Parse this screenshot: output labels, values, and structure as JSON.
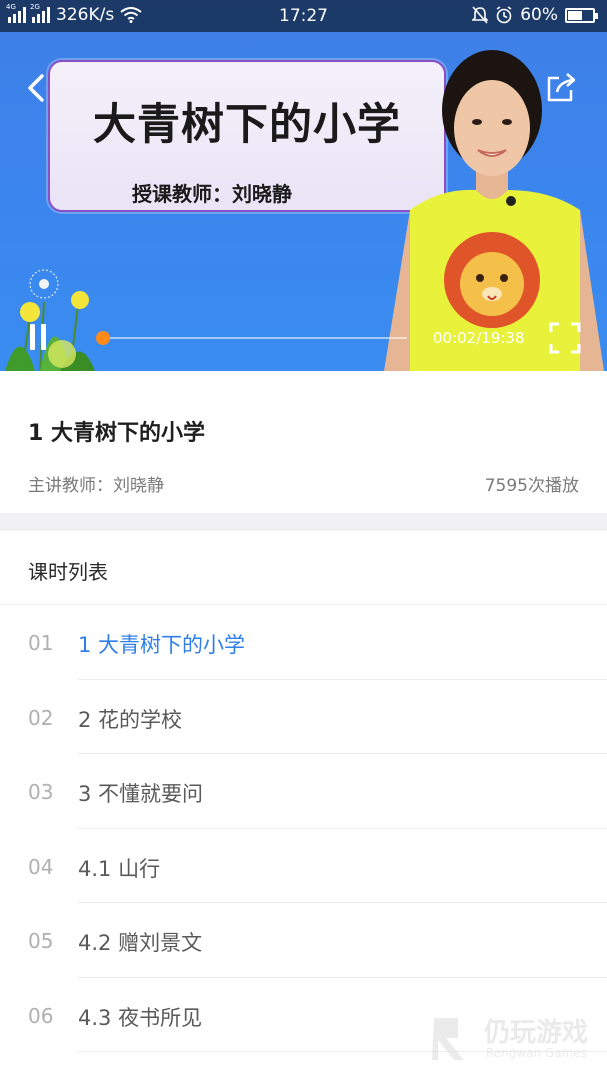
{
  "status_bar": {
    "signal_1_tag": "4G",
    "signal_2_tag": "2G",
    "network_speed": "326K/s",
    "time": "17:27",
    "battery_percent": "60%",
    "battery_level": 0.6
  },
  "player": {
    "title_card_text": "大青树下的小学",
    "title_card_teacher": "授课教师：刘晓静",
    "elapsed_time": "00:02/19:38",
    "progress": 0.002,
    "accent_color": "#ff8a1a",
    "back_icon": "chevron-left-icon",
    "share_icon": "share-icon",
    "pause_icon": "pause-icon",
    "fullscreen_icon": "fullscreen-icon"
  },
  "lesson_info": {
    "title": "1 大青树下的小学",
    "teacher": "主讲教师：刘晓静",
    "play_count": "7595次播放"
  },
  "lesson_list": {
    "header": "课时列表",
    "active_color": "#2f7fe8",
    "items": [
      {
        "num": "01",
        "name": "1 大青树下的小学",
        "active": true
      },
      {
        "num": "02",
        "name": "2 花的学校",
        "active": false
      },
      {
        "num": "03",
        "name": "3 不懂就要问",
        "active": false
      },
      {
        "num": "04",
        "name": "4.1 山行",
        "active": false
      },
      {
        "num": "05",
        "name": "4.2 赠刘景文",
        "active": false
      },
      {
        "num": "06",
        "name": "4.3 夜书所见",
        "active": false
      }
    ]
  },
  "watermark": {
    "text": "仍玩游戏",
    "sub": "Rengwan Games"
  }
}
